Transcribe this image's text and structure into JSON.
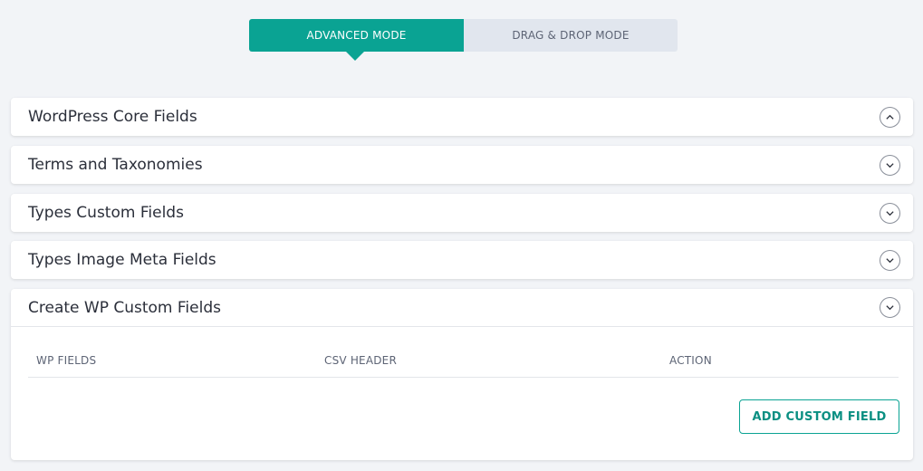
{
  "mode_switch": {
    "advanced_label": "ADVANCED MODE",
    "dragdrop_label": "DRAG & DROP MODE",
    "active": "advanced"
  },
  "panels": [
    {
      "title": "WordPress Core Fields",
      "state": "expanded-indicator"
    },
    {
      "title": "Terms and Taxonomies",
      "state": "collapsed"
    },
    {
      "title": "Types Custom Fields",
      "state": "collapsed"
    },
    {
      "title": "Types Image Meta Fields",
      "state": "collapsed"
    },
    {
      "title": "Create WP Custom Fields",
      "state": "open"
    }
  ],
  "custom_fields_table": {
    "columns": [
      "WP FIELDS",
      "CSV HEADER",
      "ACTION"
    ],
    "add_button_label": "ADD CUSTOM FIELD"
  },
  "colors": {
    "accent": "#0aa393",
    "inactive_tab": "#e1e6ee",
    "background": "#f2f4f7"
  }
}
